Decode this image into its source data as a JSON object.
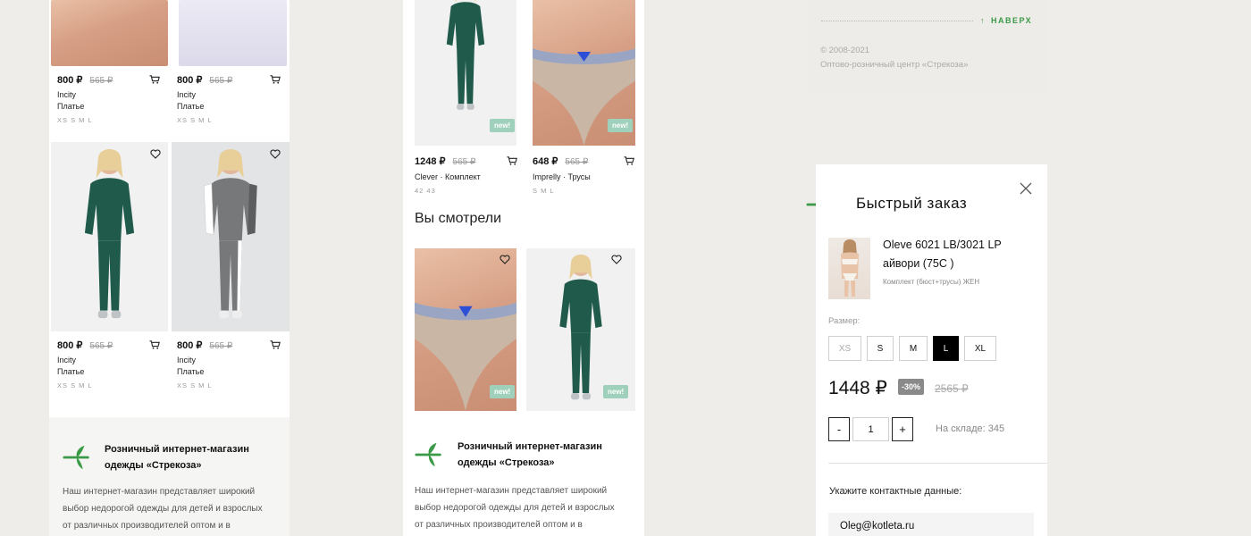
{
  "colors": {
    "accent": "#3b9a47",
    "new_badge": "#9fd0bb",
    "discount": "#8a8a8a"
  },
  "screen1": {
    "products": [
      {
        "price": "800 ₽",
        "old_price": "565 ₽",
        "brand": "Incity",
        "type": "Платье",
        "sizes": "XS  S  M  L"
      },
      {
        "price": "800 ₽",
        "old_price": "565 ₽",
        "brand": "Incity",
        "type": "Платье",
        "sizes": "XS  S  M  L"
      },
      {
        "price": "800 ₽",
        "old_price": "565 ₽",
        "brand": "Incity",
        "type": "Платье",
        "sizes": "XS  S  M  L"
      },
      {
        "price": "800 ₽",
        "old_price": "565 ₽",
        "brand": "Incity",
        "type": "Платье",
        "sizes": "XS  S  M  L"
      }
    ],
    "footer": {
      "title_line1": "Розничный интернет-магазин",
      "title_line2": "одежды «Стрекоза»",
      "text_line1": "Наш интернет-магазин представляет широкий",
      "text_line2": "выбор недорогой одежды для детей и взрослых",
      "text_line3": "от различных производителей оптом и в"
    }
  },
  "screen2": {
    "products": [
      {
        "price": "1248 ₽",
        "old_price": "565 ₽",
        "brand": "Clever",
        "type": "Комплект",
        "sizes": "42  43",
        "badge": "new!"
      },
      {
        "price": "648 ₽",
        "old_price": "565 ₽",
        "brand": "Imprelly",
        "type": "Трусы",
        "sizes": "S  M  L",
        "badge": "new!"
      }
    ],
    "section_title": "Вы смотрели",
    "viewed_badges": [
      "new!",
      "new!"
    ],
    "footer": {
      "title_line1": "Розничный интернет-магазин",
      "title_line2": "одежды «Стрекоза»",
      "text_line1": "Наш интернет-магазин представляет широкий",
      "text_line2": "выбор недорогой одежды для детей и взрослых",
      "text_line3": "от различных производителей оптом и в"
    }
  },
  "screen3_top": {
    "up_link": "НАВЕРХ",
    "copyright": "© 2008-2021",
    "company": "Оптово-розничный центр «Стрекоза»"
  },
  "quick_order": {
    "title": "Быстрый заказ",
    "product_name_line1": "Oleve 6021 LB/3021 LP",
    "product_name_line2": "айвори (75С )",
    "product_sub": "Комплект (бюст+трусы) ЖЕН",
    "size_label": "Размер:",
    "sizes": [
      "XS",
      "S",
      "M",
      "L",
      "XL"
    ],
    "selected_size": "L",
    "price": "1448 ₽",
    "discount": "-30%",
    "old_price": "2565 ₽",
    "qty_minus": "-",
    "qty_value": "1",
    "qty_plus": "+",
    "stock": "На складе: 345",
    "contact_label": "Укажите контактные данные:",
    "email_value": "Oleg@kotleta.ru"
  }
}
